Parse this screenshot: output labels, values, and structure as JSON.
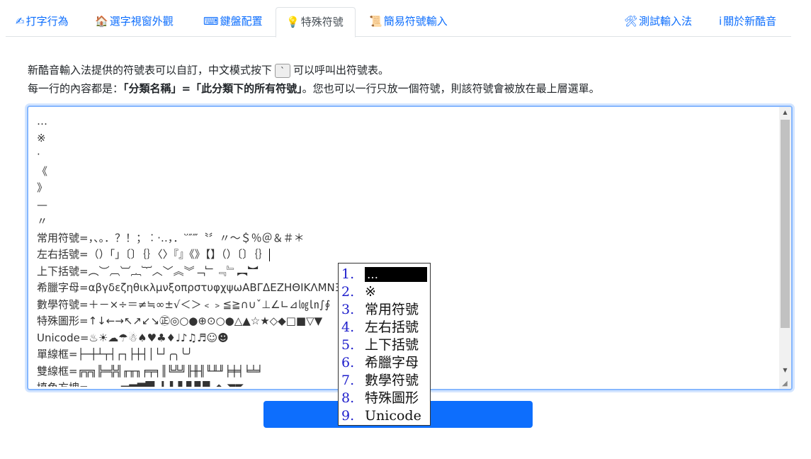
{
  "tabs": [
    {
      "icon": "✍",
      "label": "打字行為",
      "active": false
    },
    {
      "icon": "🏠",
      "label": "選字視窗外觀",
      "active": false
    },
    {
      "icon": "⌨",
      "label": "鍵盤配置",
      "active": false
    },
    {
      "icon": "💡",
      "label": "特殊符號",
      "active": true
    },
    {
      "icon": "📜",
      "label": "簡易符號輸入",
      "active": false
    },
    {
      "icon": "🛠",
      "label": "測試輸入法",
      "active": false
    },
    {
      "icon": "i",
      "label": "關於新酷音",
      "active": false
    }
  ],
  "intro": {
    "line1_a": "新酷音輸入法提供的符號表可以自訂，中文模式按下",
    "key": "`",
    "line1_b": "可以呼叫出符號表。",
    "line2_a": "每一行的內容都是：",
    "line2_bold": "「分類名稱」=「此分類下的所有符號」",
    "line2_b": "。您也可以一行只放一個符號，則該符號會被放在最上層選單。"
  },
  "editor": {
    "lines": [
      "…",
      "※",
      "‧",
      "《",
      "》",
      "—",
      "〃",
      "常用符號=，、。．？！；︰‧‥，．‵′″‴〝〞〃～＄％＠＆＃＊",
      "左右括號=（）「」〔〕｛｝〈〉『』《》【】（）〔〕｛｝",
      "上下括號=︵︶︹︺︷︸︿﹀︽︾﹁﹂﹃﹄︻︼",
      "希臘字母=αβγδεζηθικλμνξοπρστυφχψωΑΒΓΔΕΖΗΘΙΚΛΜΝΞΟΠ",
      "數學符號=＋－×÷＝≠≒∞±√＜＞﹤﹥≦≧∩∪ˇ⊥∠∟⊿㏒㏑∫∮",
      "特殊圖形=↑↓←→↖↗↙↘㊣◎○●⊕⊙○●△▲☆★◇◆□■▽▼",
      "Unicode=♨☀☁☂☃♠♥♣♦♩♪♫♬☺☻",
      "單線框=├─┼┴┬┤┌┐├┼┤│└┘╭╮╰╯",
      "雙線框=╔╦╗╠═╬╣╓╥╖╒╤╕║╚╩╝╟╫╢╙╨╜╞╪╡╘╧╛",
      "填色方塊=▁▂▃▄▅▆▇█▏▎▍▌▋▊▉◢◣◥◤"
    ]
  },
  "button": {
    "label": ""
  },
  "candidates": [
    {
      "num": "1.",
      "text": "…"
    },
    {
      "num": "2.",
      "text": "※"
    },
    {
      "num": "3.",
      "text": "常用符號"
    },
    {
      "num": "4.",
      "text": "左右括號"
    },
    {
      "num": "5.",
      "text": "上下括號"
    },
    {
      "num": "6.",
      "text": "希臘字母"
    },
    {
      "num": "7.",
      "text": "數學符號"
    },
    {
      "num": "8.",
      "text": "特殊圖形"
    },
    {
      "num": "9.",
      "text": "Unicode"
    }
  ],
  "colors": {
    "accent": "#0d6efd",
    "focus_border": "#86b7fe",
    "candidate_number": "#2020cc"
  }
}
